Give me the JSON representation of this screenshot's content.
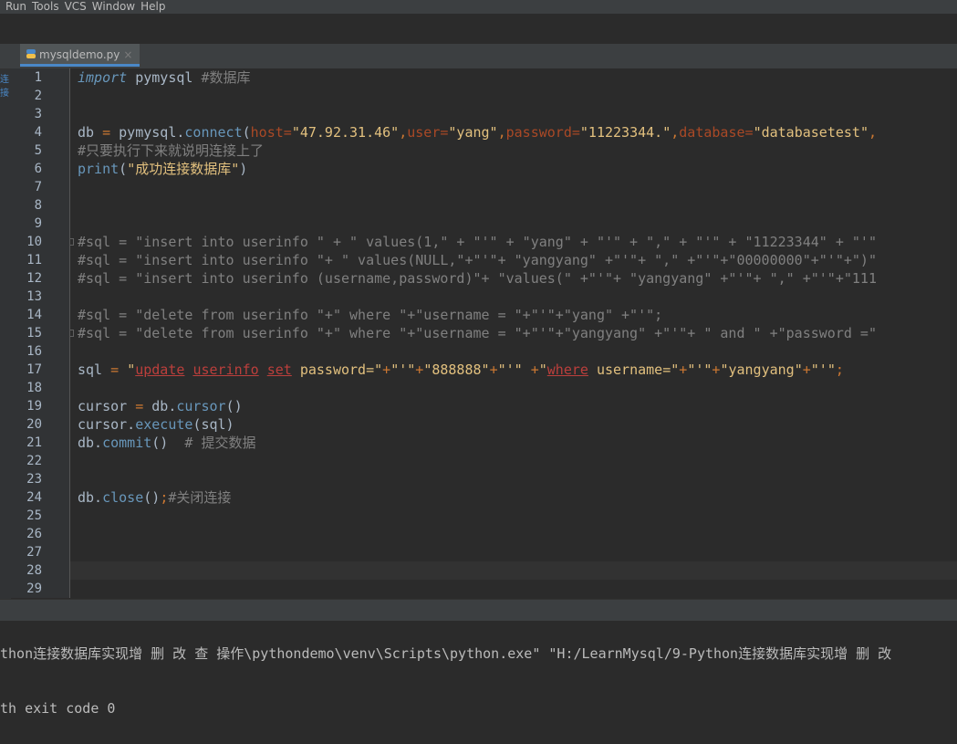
{
  "menu": [
    "Run",
    "Tools",
    "VCS",
    "Window",
    "Help"
  ],
  "tab": {
    "title": "mysqldemo.py",
    "close": "×"
  },
  "left_strip_label": "连接",
  "code": [
    {
      "n": "1",
      "segs": [
        [
          "imp",
          "import"
        ],
        [
          "",
          " pymysql "
        ],
        [
          "cm",
          "#数据库"
        ]
      ]
    },
    {
      "n": "2",
      "segs": []
    },
    {
      "n": "3",
      "segs": []
    },
    {
      "n": "4",
      "segs": [
        [
          "",
          "db "
        ],
        [
          "kw",
          "="
        ],
        [
          "",
          " pymysql."
        ],
        [
          "meth",
          "connect"
        ],
        [
          "",
          "("
        ],
        [
          "param",
          "host="
        ],
        [
          "strl",
          "\"47.92.31.46\""
        ],
        [
          "kw",
          ","
        ],
        [
          "param",
          "user="
        ],
        [
          "strl",
          "\"yang\""
        ],
        [
          "kw",
          ","
        ],
        [
          "param",
          "password="
        ],
        [
          "strl",
          "\"11223344.\""
        ],
        [
          "kw",
          ","
        ],
        [
          "param",
          "database="
        ],
        [
          "strl",
          "\"databasetest\""
        ],
        [
          "kw",
          ","
        ]
      ]
    },
    {
      "n": "5",
      "segs": [
        [
          "cm",
          "#只要执行下来就说明连接上了"
        ]
      ]
    },
    {
      "n": "6",
      "segs": [
        [
          "meth",
          "print"
        ],
        [
          "",
          "("
        ],
        [
          "strl",
          "\"成功连接数据库\""
        ],
        [
          "",
          ")"
        ]
      ]
    },
    {
      "n": "7",
      "segs": []
    },
    {
      "n": "8",
      "segs": []
    },
    {
      "n": "9",
      "segs": []
    },
    {
      "n": "10",
      "segs": [
        [
          "cm",
          "#sql = \"insert into userinfo \" + \" values(1,\" + \"'\" + \"yang\" + \"'\" + \",\" + \"'\" + \"11223344\" + \"'\""
        ]
      ]
    },
    {
      "n": "11",
      "segs": [
        [
          "cm",
          "#sql = \"insert into userinfo \"+ \" values(NULL,\"+\"'\"+ \"yangyang\" +\"'\"+ \",\" +\"'\"+\"00000000\"+\"'\"+\")\""
        ]
      ]
    },
    {
      "n": "12",
      "segs": [
        [
          "cm",
          "#sql = \"insert into userinfo (username,password)\"+ \"values(\" +\"'\"+ \"yangyang\" +\"'\"+ \",\" +\"'\"+\"111"
        ]
      ]
    },
    {
      "n": "13",
      "segs": []
    },
    {
      "n": "14",
      "segs": [
        [
          "cm",
          "#sql = \"delete from userinfo \"+\" where \"+\"username = \"+\"'\"+\"yang\" +\"'\";"
        ]
      ]
    },
    {
      "n": "15",
      "segs": [
        [
          "cm",
          "#sql = \"delete from userinfo \"+\" where \"+\"username = \"+\"'\"+\"yangyang\" +\"'\"+ \" and \" +\"password =\""
        ]
      ]
    },
    {
      "n": "16",
      "segs": []
    },
    {
      "n": "17",
      "segs": [
        [
          "",
          "sql "
        ],
        [
          "kw",
          "="
        ],
        [
          "",
          " "
        ],
        [
          "strl",
          "\""
        ],
        [
          "sqlu",
          "update"
        ],
        [
          "strl",
          " "
        ],
        [
          "sqlu",
          "userinfo"
        ],
        [
          "strl",
          " "
        ],
        [
          "sqlu",
          "set"
        ],
        [
          "strl",
          " password=\""
        ],
        [
          "kw",
          "+"
        ],
        [
          "strl",
          "\"'\""
        ],
        [
          "kw",
          "+"
        ],
        [
          "strl",
          "\"888888\""
        ],
        [
          "kw",
          "+"
        ],
        [
          "strl",
          "\"'\""
        ],
        [
          "",
          " "
        ],
        [
          "kw",
          "+"
        ],
        [
          "strl",
          "\""
        ],
        [
          "sqlu",
          "where"
        ],
        [
          "strl",
          " username=\""
        ],
        [
          "kw",
          "+"
        ],
        [
          "strl",
          "\"'\""
        ],
        [
          "kw",
          "+"
        ],
        [
          "strl",
          "\"yangyang\""
        ],
        [
          "kw",
          "+"
        ],
        [
          "strl",
          "\"'\""
        ],
        [
          "kw",
          ";"
        ]
      ]
    },
    {
      "n": "18",
      "segs": []
    },
    {
      "n": "19",
      "segs": [
        [
          "",
          "cursor "
        ],
        [
          "kw",
          "="
        ],
        [
          "",
          " db."
        ],
        [
          "meth",
          "cursor"
        ],
        [
          "",
          "()"
        ]
      ]
    },
    {
      "n": "20",
      "segs": [
        [
          "",
          "cursor."
        ],
        [
          "meth",
          "execute"
        ],
        [
          "",
          "(sql)"
        ]
      ]
    },
    {
      "n": "21",
      "segs": [
        [
          "",
          "db."
        ],
        [
          "meth",
          "commit"
        ],
        [
          "",
          "()  "
        ],
        [
          "cm",
          "# 提交数据"
        ]
      ]
    },
    {
      "n": "22",
      "segs": []
    },
    {
      "n": "23",
      "segs": []
    },
    {
      "n": "24",
      "segs": [
        [
          "",
          "db."
        ],
        [
          "meth",
          "close"
        ],
        [
          "",
          "()"
        ],
        [
          "kw",
          ";"
        ],
        [
          "cm",
          "#关闭连接"
        ]
      ]
    },
    {
      "n": "25",
      "segs": []
    },
    {
      "n": "26",
      "segs": []
    },
    {
      "n": "27",
      "segs": []
    },
    {
      "n": "28",
      "segs": []
    },
    {
      "n": "29",
      "segs": []
    }
  ],
  "current_line": "28",
  "console": {
    "line1": "thon连接数据库实现增 删 改 查 操作\\pythondemo\\venv\\Scripts\\python.exe\" \"H:/LearnMysql/9-Python连接数据库实现增 删 改",
    "line2": "th exit code 0"
  }
}
